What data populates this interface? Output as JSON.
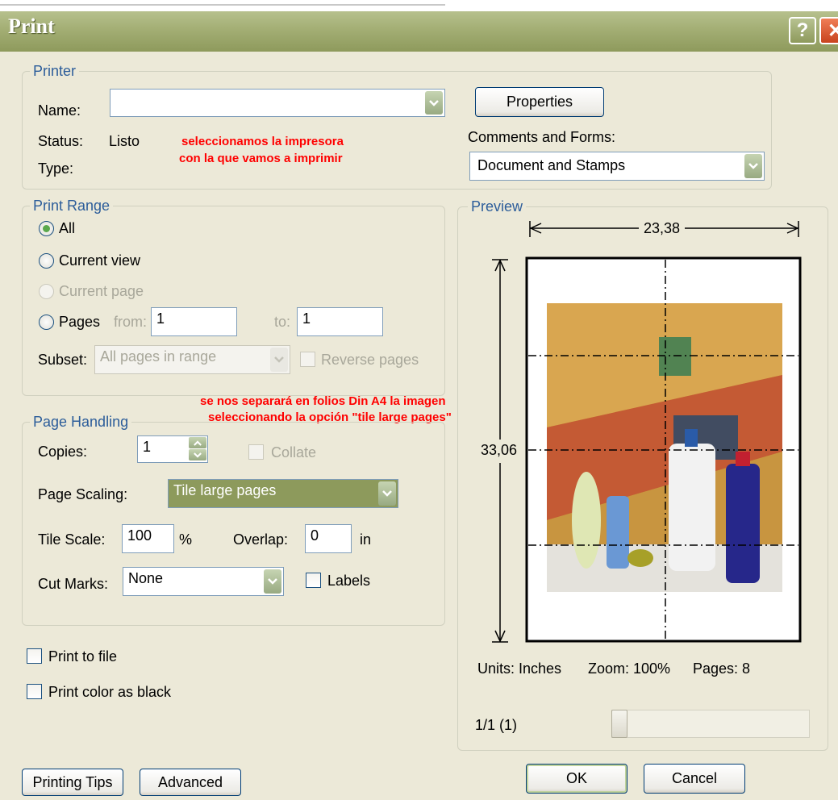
{
  "window": {
    "title": "Print",
    "help_glyph": "?",
    "close_glyph": "✕"
  },
  "printer": {
    "legend": "Printer",
    "name_label": "Name:",
    "name_value": "",
    "status_label": "Status:",
    "status_value": "Listo",
    "type_label": "Type:",
    "type_value": "",
    "note_line1": "seleccionamos la impresora",
    "note_line2": "con la que vamos a imprimir",
    "properties_label": "Properties",
    "comments_label": "Comments and Forms:",
    "comments_value": "Document and Stamps"
  },
  "print_range": {
    "legend": "Print Range",
    "all_label": "All",
    "current_view_label": "Current view",
    "current_page_label": "Current page",
    "pages_label": "Pages",
    "from_label": "from:",
    "from_value": "1",
    "to_label": "to:",
    "to_value": "1",
    "subset_label": "Subset:",
    "subset_value": "All pages in range",
    "reverse_label": "Reverse pages",
    "selected": "All"
  },
  "annotation_tile": {
    "line1": "se nos separará en folios Din A4 la imagen",
    "line2": "seleccionando la opción \"tile large pages\""
  },
  "page_handling": {
    "legend": "Page Handling",
    "copies_label": "Copies:",
    "copies_value": "1",
    "collate_label": "Collate",
    "scaling_label": "Page Scaling:",
    "scaling_value": "Tile large pages",
    "tile_scale_label": "Tile Scale:",
    "tile_scale_value": "100",
    "percent_sign": "%",
    "overlap_label": "Overlap:",
    "overlap_value": "0",
    "overlap_unit": "in",
    "cut_marks_label": "Cut Marks:",
    "cut_marks_value": "None",
    "labels_label": "Labels"
  },
  "options": {
    "print_to_file_label": "Print to file",
    "print_color_black_label": "Print color as black"
  },
  "preview": {
    "legend": "Preview",
    "width_value": "23,38",
    "height_value": "33,06",
    "units_label": "Units: Inches",
    "zoom_label": "Zoom: 100%",
    "pages_label": "Pages: 8",
    "page_counter": "1/1 (1)",
    "slider_position": 0
  },
  "buttons": {
    "printing_tips": "Printing Tips",
    "advanced": "Advanced",
    "ok": "OK",
    "cancel": "Cancel"
  },
  "colors": {
    "title_bar": "#a3ae74",
    "dialog_bg": "#ece9d8",
    "group_label": "#2c5d9a",
    "annotation": "#ff0000",
    "selected_dropdown": "#8d9a5c"
  },
  "icons": [
    "help-icon",
    "close-icon",
    "dropdown-arrow-icon",
    "spin-up-icon",
    "spin-down-icon"
  ]
}
